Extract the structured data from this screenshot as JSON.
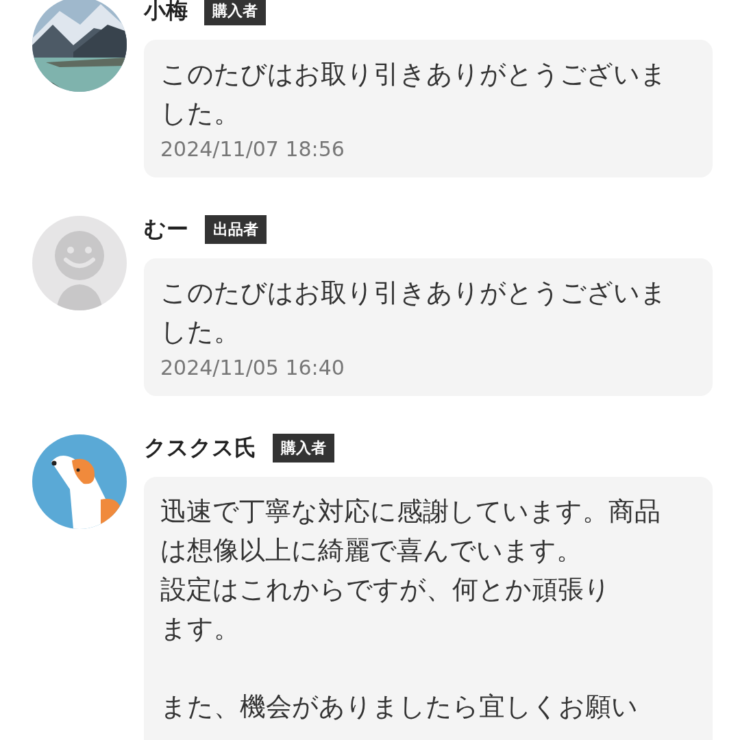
{
  "messages": [
    {
      "avatar": {
        "kind": "landscape"
      },
      "name": "小梅",
      "role": "購入者",
      "paragraphs": [
        [
          "このたびはお取り引きありがとうございました。"
        ]
      ],
      "time": "2024/11/07 18:56"
    },
    {
      "avatar": {
        "kind": "default"
      },
      "name": "むー",
      "role": "出品者",
      "paragraphs": [
        [
          "このたびはお取り引きありがとうございました。"
        ]
      ],
      "time": "2024/11/05 16:40"
    },
    {
      "avatar": {
        "kind": "dog"
      },
      "name": "クスクス氏",
      "role": "購入者",
      "paragraphs": [
        [
          "迅速で丁寧な対応に感謝しています。商品は想像以上に綺麗で喜んでいます。",
          "設定はこれからですが、何とか頑張り",
          "ます。"
        ],
        [
          "また、機会がありましたら宜しくお願い"
        ]
      ]
    }
  ]
}
